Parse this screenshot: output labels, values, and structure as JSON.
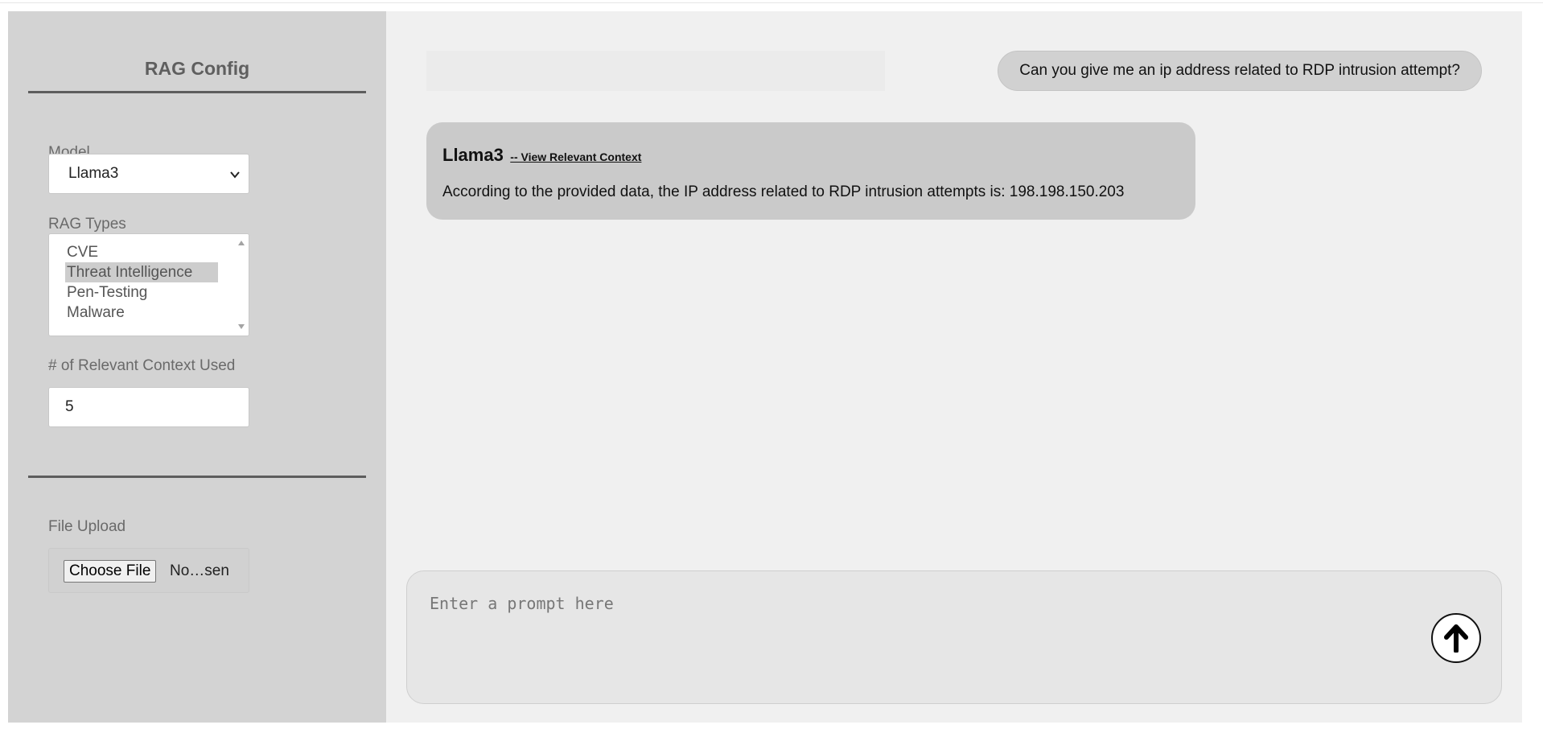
{
  "sidebar": {
    "title": "RAG Config",
    "model": {
      "label": "Model",
      "value": "Llama3"
    },
    "rag_types": {
      "label": "RAG Types",
      "options": [
        "CVE",
        "Threat Intelligence",
        "Pen-Testing",
        "Malware"
      ],
      "selected": "Threat Intelligence"
    },
    "context_count": {
      "label": "# of Relevant Context Used",
      "value": "5"
    },
    "file_upload": {
      "label": "File Upload",
      "button_label": "Choose File",
      "status": "No…sen"
    }
  },
  "chat": {
    "user_message": "Can you give me an ip address related to RDP intrusion attempt?",
    "bot_name": "Llama3",
    "context_link": "-- View Relevant Context",
    "bot_message": "According to the provided data, the IP address related to RDP intrusion attempts is: 198.198.150.203"
  },
  "prompt": {
    "placeholder": "Enter a prompt here",
    "send_icon": "arrow-up-icon"
  },
  "colors": {
    "sidebar_bg": "#d3d3d3",
    "main_bg": "#f0f0f0",
    "bubble_bg": "#cacaca"
  }
}
